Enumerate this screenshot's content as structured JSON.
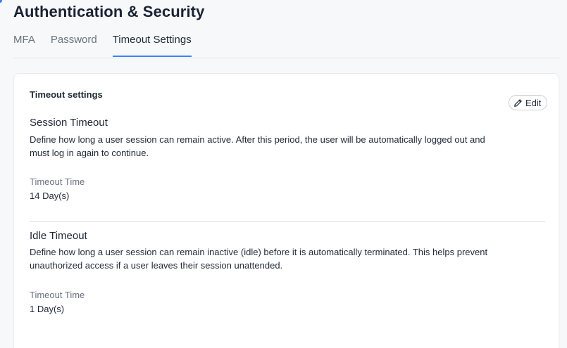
{
  "header": {
    "title": "Authentication & Security"
  },
  "tabs": [
    {
      "label": "MFA",
      "active": false
    },
    {
      "label": "Password",
      "active": false
    },
    {
      "label": "Timeout Settings",
      "active": true
    }
  ],
  "card": {
    "title": "Timeout settings",
    "edit_label": "Edit",
    "edit_icon": "pencil-icon",
    "sections": [
      {
        "title": "Session Timeout",
        "description": "Define how long a user session can remain active. After this period, the user will be automatically logged out and must log in again to continue.",
        "field_label": "Timeout Time",
        "field_value": "14 Day(s)"
      },
      {
        "title": "Idle Timeout",
        "description": "Define how long a user session can remain inactive (idle) before it is automatically terminated. This helps prevent unauthorized access if a user leaves their session unattended.",
        "field_label": "Timeout Time",
        "field_value": "1 Day(s)"
      }
    ]
  },
  "colors": {
    "accent": "#3b82f6",
    "background": "#f7f8fa",
    "card": "#ffffff"
  }
}
